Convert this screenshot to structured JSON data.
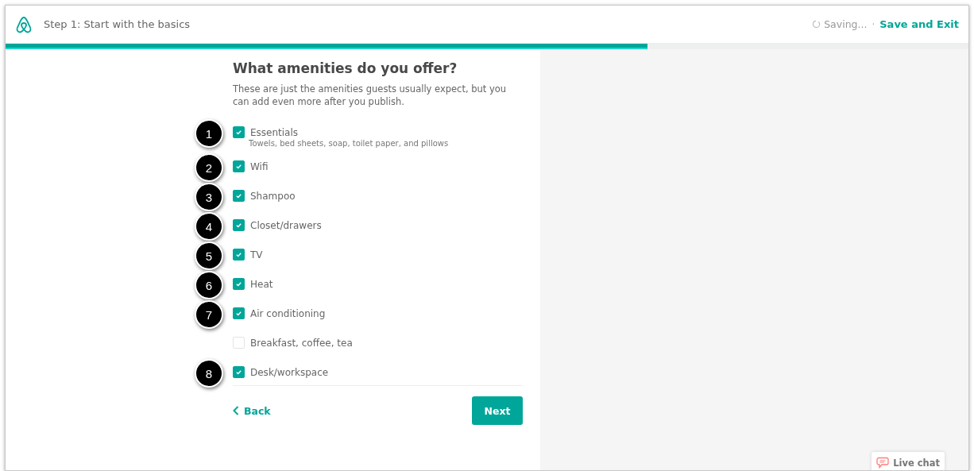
{
  "header": {
    "step_title": "Step 1: Start with the basics",
    "saving_status": "Saving...",
    "separator": "·",
    "save_exit_link": "Save and Exit"
  },
  "progress": {
    "level": 0.667
  },
  "form": {
    "title": "What amenities do you offer?",
    "subtitle": "These are just the amenities guests usually expect, but you can add even more after you publish.",
    "amenities": [
      {
        "label": "Essentials",
        "description": "Towels, bed sheets, soap, toilet paper, and pillows",
        "checked": true,
        "callout": "1"
      },
      {
        "label": "Wifi",
        "checked": true,
        "callout": "2"
      },
      {
        "label": "Shampoo",
        "checked": true,
        "callout": "3"
      },
      {
        "label": "Closet/drawers",
        "checked": true,
        "callout": "4"
      },
      {
        "label": "TV",
        "checked": true,
        "callout": "5"
      },
      {
        "label": "Heat",
        "checked": true,
        "callout": "6"
      },
      {
        "label": "Air conditioning",
        "checked": true,
        "callout": "7"
      },
      {
        "label": "Breakfast, coffee, tea",
        "checked": false
      },
      {
        "label": "Desk/workspace",
        "checked": true,
        "callout": "8"
      }
    ],
    "back_link": "Back",
    "next_button": "Next"
  },
  "live_chat": {
    "label": "Live chat"
  }
}
